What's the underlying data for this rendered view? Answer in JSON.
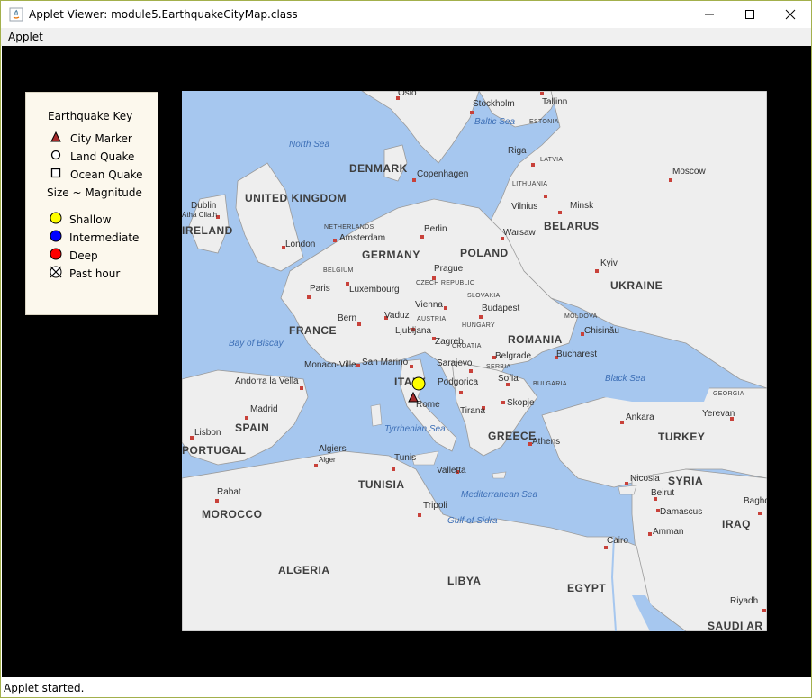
{
  "window": {
    "title": "Applet Viewer: module5.EarthquakeCityMap.class",
    "minimize_icon": "minimize-icon",
    "maximize_icon": "maximize-icon",
    "close_icon": "close-icon"
  },
  "menubar": {
    "items": [
      "Applet"
    ]
  },
  "legend": {
    "title": "Earthquake Key",
    "city_marker": "City Marker",
    "land_quake": "Land Quake",
    "ocean_quake": "Ocean Quake",
    "size_note": "Size ~ Magnitude",
    "shallow": "Shallow",
    "intermediate": "Intermediate",
    "deep": "Deep",
    "past_hour": "Past hour",
    "colors": {
      "shallow": "#ffff00",
      "intermediate": "#0000ff",
      "deep": "#ff0000",
      "city": "#a52a2a"
    }
  },
  "map": {
    "countries": [
      "UNITED KINGDOM",
      "IRELAND",
      "DENMARK",
      "GERMANY",
      "POLAND",
      "BELARUS",
      "UKRAINE",
      "FRANCE",
      "ITALY",
      "ROMANIA",
      "SPAIN",
      "GREECE",
      "TURKEY",
      "TUNISIA",
      "MOROCCO",
      "SYRIA",
      "IRAQ",
      "ALGERIA",
      "LIBYA",
      "EGYPT",
      "PORTUGAL",
      "SAUDI AR"
    ],
    "small_countries": [
      "NETHERLANDS",
      "BELGIUM",
      "CZECH REPUBLIC",
      "SLOVAKIA",
      "AUSTRIA",
      "HUNGARY",
      "CROATIA",
      "SERBIA",
      "BULGARIA",
      "MOLDOVA",
      "LATVIA",
      "LITHUANIA",
      "ESTONIA",
      "GEORGIA"
    ],
    "cities": [
      "Oslo",
      "Stockholm",
      "Tallinn",
      "Riga",
      "Moscow",
      "Copenhagen",
      "Vilnius",
      "Minsk",
      "Dublin",
      "Atha Cliath",
      "Amsterdam",
      "Berlin",
      "Warsaw",
      "London",
      "Kyiv",
      "Prague",
      "Paris",
      "Luxembourg",
      "Vienna",
      "Budapest",
      "Chișinău",
      "Bern",
      "Vaduz",
      "Ljubljana",
      "Zagreb",
      "Monaco-Ville",
      "San Marino",
      "Sarajevo",
      "Belgrade",
      "Bucharest",
      "Andorra la Vella",
      "Podgorica",
      "Sofia",
      "Skopje",
      "Tirana",
      "Rome",
      "Madrid",
      "Ankara",
      "Yerevan",
      "Lisbon",
      "Athens",
      "Algiers",
      "Alger",
      "Tunis",
      "Valletta",
      "Nicosia",
      "Beirut",
      "Damascus",
      "Amman",
      "Rabat",
      "Tripoli",
      "Cairo",
      "Riyadh",
      "Baghdad"
    ],
    "seas": [
      "North Sea",
      "Baltic Sea",
      "Bay of Biscay",
      "Black Sea",
      "Tyrrhenian Sea",
      "Mediterranean Sea",
      "Gulf of Sidra"
    ],
    "markers": {
      "shallow_quake": "shallow-quake-marker",
      "city_marker": "city-marker-rome"
    }
  },
  "status": {
    "text": "Applet started."
  }
}
